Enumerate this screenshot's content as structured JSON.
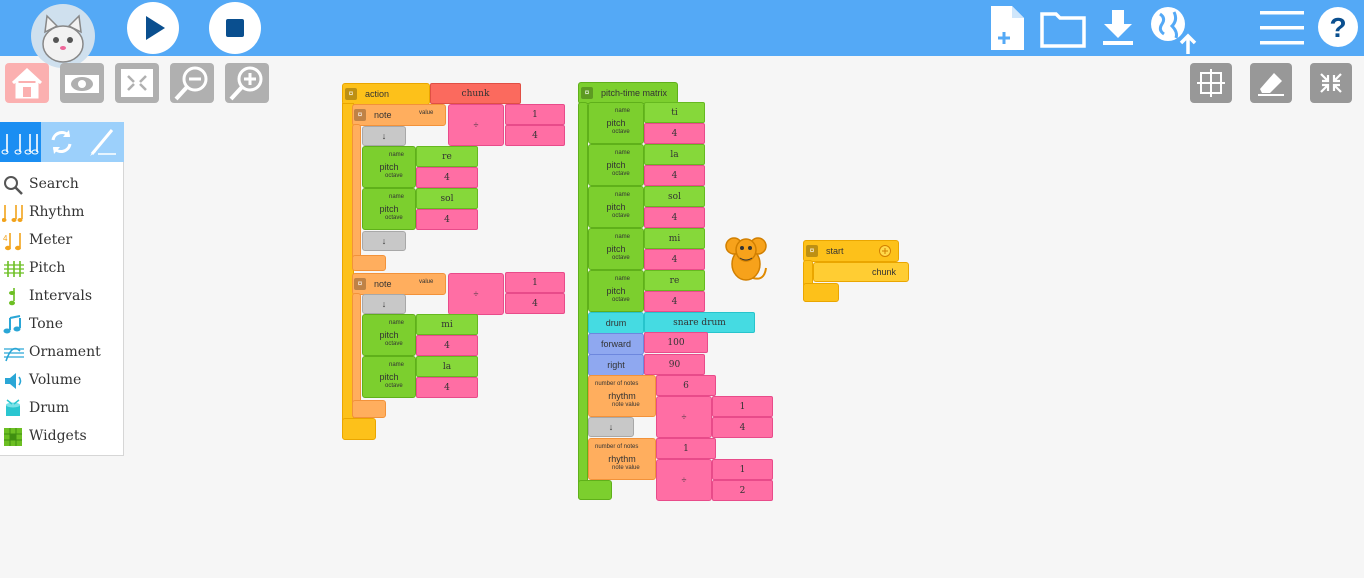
{
  "toolbar": {
    "left": [
      "mouse-logo",
      "play-icon",
      "stop-icon"
    ],
    "right": [
      "new-file-icon",
      "open-folder-icon",
      "save-download-icon",
      "planet-icon",
      "menu-icon",
      "help-icon"
    ],
    "color": "#54a9f6"
  },
  "secondary_toolbar": [
    "home-icon",
    "hide-blocks-icon",
    "collapse-blocks-icon",
    "zoom-out-icon",
    "zoom-in-icon"
  ],
  "right_tools": [
    "grid-icon",
    "clear-icon",
    "collapse-icon"
  ],
  "palette": {
    "tabs": [
      "music-tab",
      "flow-tab",
      "art-tab"
    ],
    "items": [
      {
        "label": "Search",
        "icon": "search-icon"
      },
      {
        "label": "Rhythm",
        "icon": "rhythm-icon"
      },
      {
        "label": "Meter",
        "icon": "meter-icon"
      },
      {
        "label": "Pitch",
        "icon": "pitch-icon"
      },
      {
        "label": "Intervals",
        "icon": "intervals-icon"
      },
      {
        "label": "Tone",
        "icon": "tone-icon"
      },
      {
        "label": "Ornament",
        "icon": "ornament-icon"
      },
      {
        "label": "Volume",
        "icon": "volume-icon"
      },
      {
        "label": "Drum",
        "icon": "drum-icon"
      },
      {
        "label": "Widgets",
        "icon": "widgets-icon"
      }
    ]
  },
  "blocks": {
    "labels": {
      "action": "action",
      "note": "note",
      "value": "value",
      "name": "name",
      "pitch": "pitch",
      "octave": "octave",
      "down": "↓",
      "divide": "÷",
      "matrix": "pitch-time matrix",
      "drum": "drum",
      "forward": "forward",
      "right": "right",
      "number_of_notes": "number of notes",
      "rhythm": "rhythm",
      "note_value": "note value",
      "start": "start"
    },
    "action": {
      "name": "chunk",
      "note1": {
        "num": "1",
        "den": "4",
        "pitches": [
          {
            "name": "re",
            "octave": "4"
          },
          {
            "name": "sol",
            "octave": "4"
          }
        ]
      },
      "note2": {
        "num": "1",
        "den": "4",
        "pitches": [
          {
            "name": "mi",
            "octave": "4"
          },
          {
            "name": "la",
            "octave": "4"
          }
        ]
      }
    },
    "matrix": {
      "pitches": [
        {
          "name": "ti",
          "octave": "4"
        },
        {
          "name": "la",
          "octave": "4"
        },
        {
          "name": "sol",
          "octave": "4"
        },
        {
          "name": "mi",
          "octave": "4"
        },
        {
          "name": "re",
          "octave": "4"
        }
      ],
      "drum": "snare drum",
      "forward": "100",
      "right": "90",
      "rhythm1": {
        "count": "6",
        "num": "1",
        "den": "4"
      },
      "rhythm2": {
        "count": "1",
        "num": "1",
        "den": "2"
      }
    },
    "start": {
      "action": "chunk"
    }
  }
}
